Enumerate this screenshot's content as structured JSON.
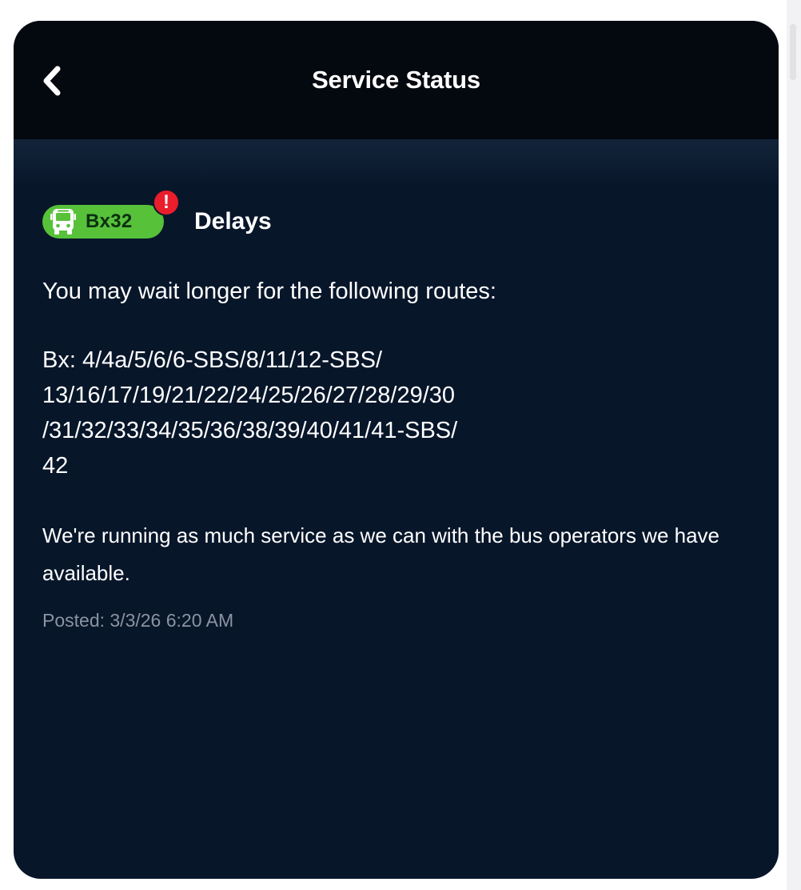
{
  "header": {
    "back_icon": "chevron-left-icon",
    "title": "Service Status"
  },
  "alert": {
    "route_icon": "bus-icon",
    "route": "Bx32",
    "route_color": "#57c13a",
    "badge_icon": "exclamation-icon",
    "badge_symbol": "!",
    "badge_color": "#ea1d2c",
    "status": "Delays",
    "lead": "You may wait longer for the following routes:",
    "affected_routes_lines": [
      "Bx: 4/4a/5/6/6-SBS/8/11/12-SBS/",
      "13/16/17/19/21/22/24/25/26/27/28/29/30",
      "/31/32/33/34/35/36/38/39/40/41/41-SBS/",
      "42"
    ],
    "message": "We're running as much service as we can with the bus operators we have available.",
    "posted": "Posted: 3/3/26 6:20 AM"
  },
  "colors": {
    "card_background": "#08162a",
    "header_background": "#04080f",
    "posted_text": "#8a93a1"
  }
}
